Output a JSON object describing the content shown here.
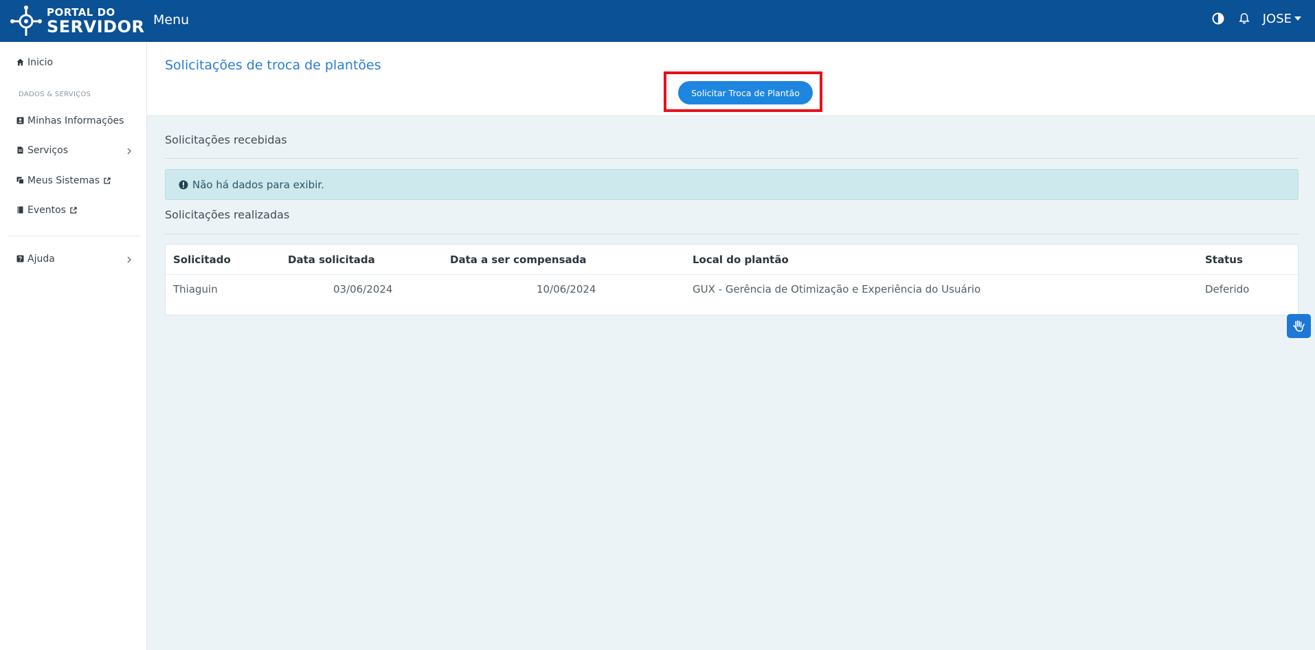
{
  "header": {
    "logo_line1": "PORTAL DO",
    "logo_line2": "SERVIDOR",
    "menu_label": "Menu",
    "user_name": "JOSE"
  },
  "sidebar": {
    "section_label": "DADOS & SERVIÇOS",
    "items": [
      {
        "label": "Inicio",
        "icon": "home-icon"
      },
      {
        "label": "Minhas Informações",
        "icon": "id-card-icon"
      },
      {
        "label": "Serviços",
        "icon": "document-icon"
      },
      {
        "label": "Meus Sistemas",
        "icon": "copy-icon"
      },
      {
        "label": "Eventos",
        "icon": "book-icon"
      },
      {
        "label": "Ajuda",
        "icon": "question-icon"
      }
    ]
  },
  "page": {
    "title": "Solicitações de troca de plantões",
    "request_button": "Solicitar Troca de Plantão"
  },
  "received": {
    "title": "Solicitações recebidas",
    "empty_message": "Não há dados para exibir."
  },
  "made": {
    "title": "Solicitações realizadas",
    "columns": [
      "Solicitado",
      "Data solicitada",
      "Data a ser compensada",
      "Local do plantão",
      "Status"
    ],
    "rows": [
      [
        "Thiaguin",
        "03/06/2024",
        "10/06/2024",
        "GUX - Gerência de Otimização e Experiência do Usuário",
        "Deferido"
      ]
    ]
  },
  "colors": {
    "topbar": "#0a5196",
    "accent": "#1e86df",
    "highlight": "#e8101c",
    "alert_bg": "#cde9ee"
  }
}
